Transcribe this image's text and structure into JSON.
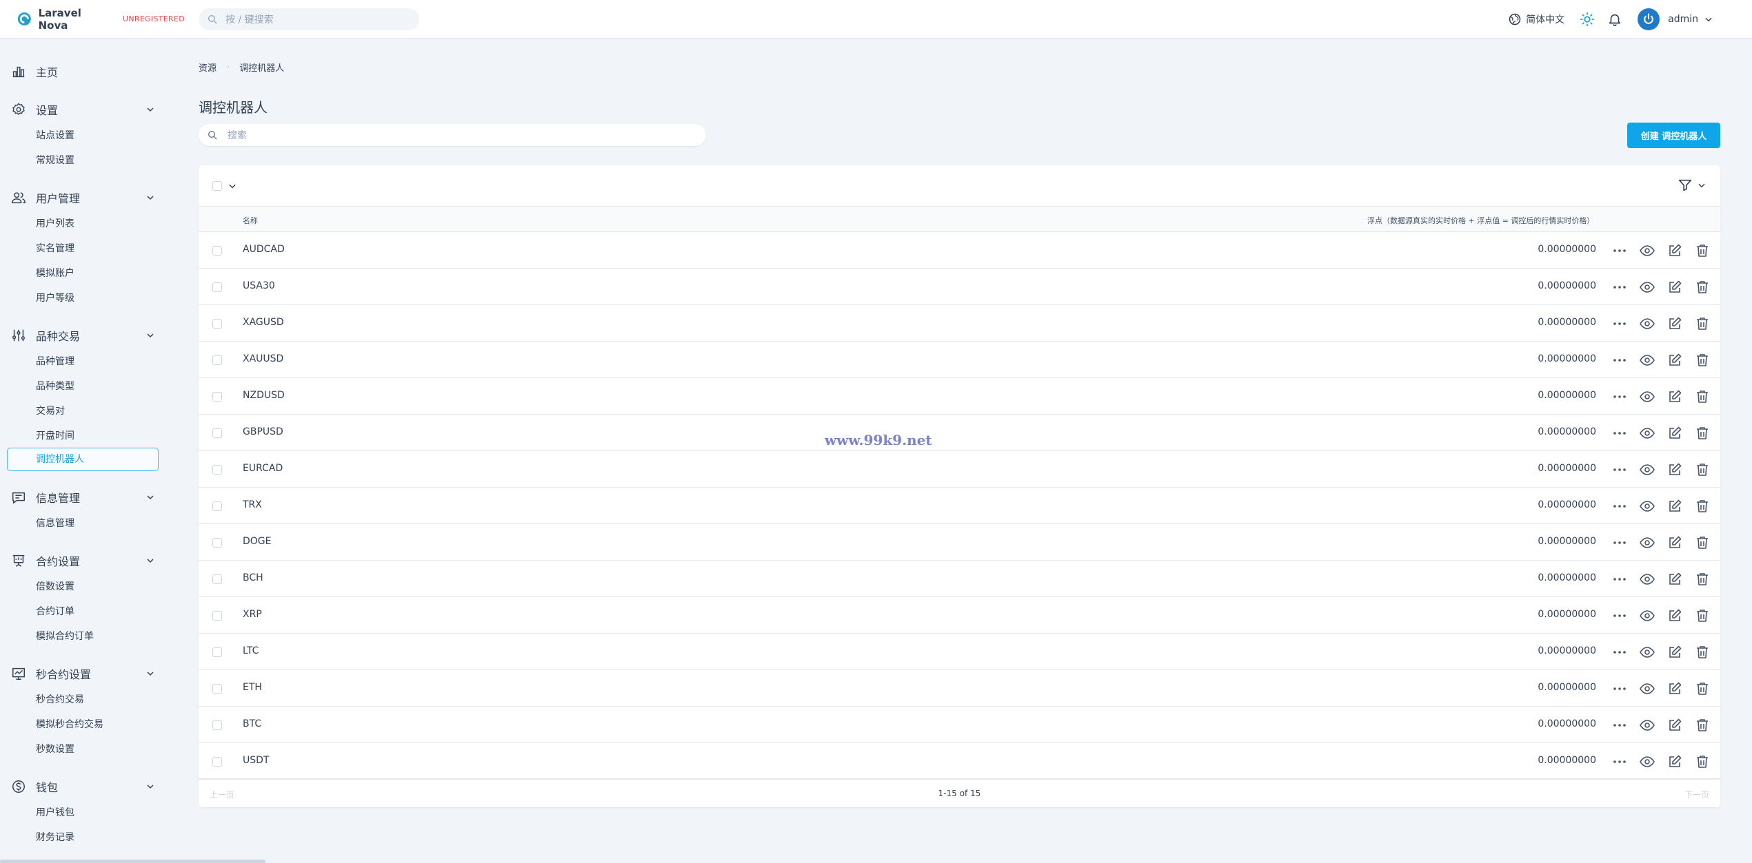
{
  "brand": {
    "name": "Laravel Nova",
    "badge": "UNREGISTERED"
  },
  "header": {
    "search_placeholder": "按 / 键搜索",
    "language": "简体中文",
    "user": "admin"
  },
  "sidebar": {
    "sections": [
      {
        "label": "主页",
        "icon": "chart-bar-icon",
        "items": []
      },
      {
        "label": "设置",
        "icon": "gear-icon",
        "items": [
          "站点设置",
          "常规设置"
        ]
      },
      {
        "label": "用户管理",
        "icon": "users-icon",
        "items": [
          "用户列表",
          "实名管理",
          "模拟账户",
          "用户等级"
        ]
      },
      {
        "label": "品种交易",
        "icon": "sliders-icon",
        "items": [
          "品种管理",
          "品种类型",
          "交易对",
          "开盘时间",
          "调控机器人"
        ]
      },
      {
        "label": "信息管理",
        "icon": "chat-icon",
        "items": [
          "信息管理"
        ]
      },
      {
        "label": "合约设置",
        "icon": "presentation-icon",
        "items": [
          "倍数设置",
          "合约订单",
          "模拟合约订单"
        ]
      },
      {
        "label": "秒合约设置",
        "icon": "chart-line-icon",
        "items": [
          "秒合约交易",
          "模拟秒合约交易",
          "秒数设置"
        ]
      },
      {
        "label": "钱包",
        "icon": "dollar-icon",
        "items": [
          "用户钱包",
          "财务记录"
        ]
      }
    ],
    "active_item": "调控机器人"
  },
  "breadcrumb": {
    "root": "资源",
    "current": "调控机器人"
  },
  "page": {
    "title": "调控机器人",
    "search_placeholder": "搜索",
    "create_button": "创建 调控机器人"
  },
  "table": {
    "columns": {
      "name": "名称",
      "float": "浮点（数据源真实的实时价格 + 浮点值 = 调控后的行情实时价格）"
    },
    "rows": [
      {
        "name": "AUDCAD",
        "value": "0.00000000"
      },
      {
        "name": "USA30",
        "value": "0.00000000"
      },
      {
        "name": "XAGUSD",
        "value": "0.00000000"
      },
      {
        "name": "XAUUSD",
        "value": "0.00000000"
      },
      {
        "name": "NZDUSD",
        "value": "0.00000000"
      },
      {
        "name": "GBPUSD",
        "value": "0.00000000"
      },
      {
        "name": "EURCAD",
        "value": "0.00000000"
      },
      {
        "name": "TRX",
        "value": "0.00000000"
      },
      {
        "name": "DOGE",
        "value": "0.00000000"
      },
      {
        "name": "BCH",
        "value": "0.00000000"
      },
      {
        "name": "XRP",
        "value": "0.00000000"
      },
      {
        "name": "LTC",
        "value": "0.00000000"
      },
      {
        "name": "ETH",
        "value": "0.00000000"
      },
      {
        "name": "BTC",
        "value": "0.00000000"
      },
      {
        "name": "USDT",
        "value": "0.00000000"
      }
    ]
  },
  "pagination": {
    "prev": "上一页",
    "info": "1-15 of 15",
    "next": "下一页"
  },
  "watermark": "www.99k9.net",
  "colors": {
    "accent": "#0ea5e9",
    "brand_logo": "#1e9ecf",
    "badge": "#ef4444"
  }
}
